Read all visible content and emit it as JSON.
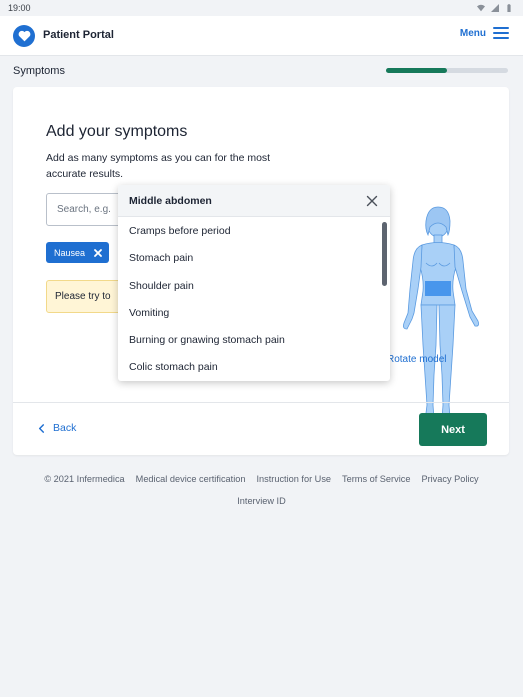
{
  "status_bar": {
    "time": "19:00",
    "icons": [
      "wifi-icon",
      "signal-icon",
      "battery-icon"
    ]
  },
  "header": {
    "app_name": "Patient Portal",
    "menu_label": "Menu",
    "logo_icon": "heart-icon",
    "accent": "#1f6fd1"
  },
  "progress": {
    "section": "Symptoms",
    "fraction": 0.5,
    "color": "#16795a"
  },
  "card": {
    "title": "Add your symptoms",
    "subtitle": "Add as many symptoms as you can for the most accurate results.",
    "search_placeholder": "Search, e.g.",
    "selected_symptoms": [
      {
        "label": "Nausea"
      }
    ],
    "notice": "Please try to",
    "rotate_label": "Rotate model",
    "back_label": "Back",
    "next_label": "Next"
  },
  "dropdown": {
    "title": "Middle abdomen",
    "items": [
      "Cramps before period",
      "Stomach pain",
      "Shoulder pain",
      "Vomiting",
      "Burning or gnawing stomach pain",
      "Colic stomach pain"
    ]
  },
  "footer": {
    "links": [
      "© 2021 Infermedica",
      "Medical device certification",
      "Instruction for Use",
      "Terms of Service",
      "Privacy Policy"
    ],
    "interview_id": "Interview ID"
  }
}
